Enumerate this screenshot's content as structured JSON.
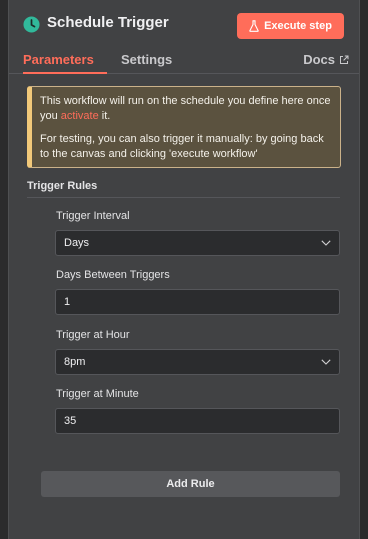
{
  "header": {
    "title": "Schedule Trigger",
    "execute_label": "Execute step",
    "accent_color": "#ff6d5a"
  },
  "tabs": [
    {
      "label": "Parameters",
      "active": true
    },
    {
      "label": "Settings",
      "active": false
    }
  ],
  "docs_label": "Docs",
  "notice": {
    "line1_before": "This workflow will run on the schedule you define here once you ",
    "line1_link": "activate",
    "line1_after": " it.",
    "line2": "For testing, you can also trigger it manually: by going back to the canvas and clicking 'execute workflow'"
  },
  "section_title": "Trigger Rules",
  "fields": [
    {
      "label": "Trigger Interval",
      "value": "Days",
      "type": "select"
    },
    {
      "label": "Days Between Triggers",
      "value": "1",
      "type": "input"
    },
    {
      "label": "Trigger at Hour",
      "value": "8pm",
      "type": "select"
    },
    {
      "label": "Trigger at Minute",
      "value": "35",
      "type": "input"
    }
  ],
  "add_rule_label": "Add Rule",
  "icons": {
    "node": "clock-icon",
    "execute": "flask-icon",
    "docs": "external-link-icon",
    "select": "chevron-down-icon"
  }
}
